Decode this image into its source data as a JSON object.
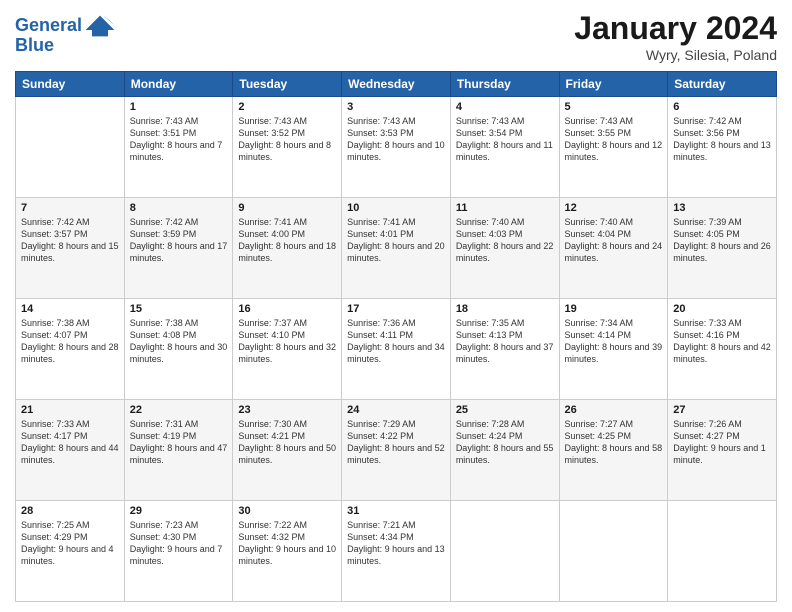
{
  "logo": {
    "line1": "General",
    "line2": "Blue"
  },
  "header": {
    "month": "January 2024",
    "location": "Wyry, Silesia, Poland"
  },
  "weekdays": [
    "Sunday",
    "Monday",
    "Tuesday",
    "Wednesday",
    "Thursday",
    "Friday",
    "Saturday"
  ],
  "weeks": [
    [
      {
        "day": "",
        "sunrise": "",
        "sunset": "",
        "daylight": ""
      },
      {
        "day": "1",
        "sunrise": "Sunrise: 7:43 AM",
        "sunset": "Sunset: 3:51 PM",
        "daylight": "Daylight: 8 hours and 7 minutes."
      },
      {
        "day": "2",
        "sunrise": "Sunrise: 7:43 AM",
        "sunset": "Sunset: 3:52 PM",
        "daylight": "Daylight: 8 hours and 8 minutes."
      },
      {
        "day": "3",
        "sunrise": "Sunrise: 7:43 AM",
        "sunset": "Sunset: 3:53 PM",
        "daylight": "Daylight: 8 hours and 10 minutes."
      },
      {
        "day": "4",
        "sunrise": "Sunrise: 7:43 AM",
        "sunset": "Sunset: 3:54 PM",
        "daylight": "Daylight: 8 hours and 11 minutes."
      },
      {
        "day": "5",
        "sunrise": "Sunrise: 7:43 AM",
        "sunset": "Sunset: 3:55 PM",
        "daylight": "Daylight: 8 hours and 12 minutes."
      },
      {
        "day": "6",
        "sunrise": "Sunrise: 7:42 AM",
        "sunset": "Sunset: 3:56 PM",
        "daylight": "Daylight: 8 hours and 13 minutes."
      }
    ],
    [
      {
        "day": "7",
        "sunrise": "Sunrise: 7:42 AM",
        "sunset": "Sunset: 3:57 PM",
        "daylight": "Daylight: 8 hours and 15 minutes."
      },
      {
        "day": "8",
        "sunrise": "Sunrise: 7:42 AM",
        "sunset": "Sunset: 3:59 PM",
        "daylight": "Daylight: 8 hours and 17 minutes."
      },
      {
        "day": "9",
        "sunrise": "Sunrise: 7:41 AM",
        "sunset": "Sunset: 4:00 PM",
        "daylight": "Daylight: 8 hours and 18 minutes."
      },
      {
        "day": "10",
        "sunrise": "Sunrise: 7:41 AM",
        "sunset": "Sunset: 4:01 PM",
        "daylight": "Daylight: 8 hours and 20 minutes."
      },
      {
        "day": "11",
        "sunrise": "Sunrise: 7:40 AM",
        "sunset": "Sunset: 4:03 PM",
        "daylight": "Daylight: 8 hours and 22 minutes."
      },
      {
        "day": "12",
        "sunrise": "Sunrise: 7:40 AM",
        "sunset": "Sunset: 4:04 PM",
        "daylight": "Daylight: 8 hours and 24 minutes."
      },
      {
        "day": "13",
        "sunrise": "Sunrise: 7:39 AM",
        "sunset": "Sunset: 4:05 PM",
        "daylight": "Daylight: 8 hours and 26 minutes."
      }
    ],
    [
      {
        "day": "14",
        "sunrise": "Sunrise: 7:38 AM",
        "sunset": "Sunset: 4:07 PM",
        "daylight": "Daylight: 8 hours and 28 minutes."
      },
      {
        "day": "15",
        "sunrise": "Sunrise: 7:38 AM",
        "sunset": "Sunset: 4:08 PM",
        "daylight": "Daylight: 8 hours and 30 minutes."
      },
      {
        "day": "16",
        "sunrise": "Sunrise: 7:37 AM",
        "sunset": "Sunset: 4:10 PM",
        "daylight": "Daylight: 8 hours and 32 minutes."
      },
      {
        "day": "17",
        "sunrise": "Sunrise: 7:36 AM",
        "sunset": "Sunset: 4:11 PM",
        "daylight": "Daylight: 8 hours and 34 minutes."
      },
      {
        "day": "18",
        "sunrise": "Sunrise: 7:35 AM",
        "sunset": "Sunset: 4:13 PM",
        "daylight": "Daylight: 8 hours and 37 minutes."
      },
      {
        "day": "19",
        "sunrise": "Sunrise: 7:34 AM",
        "sunset": "Sunset: 4:14 PM",
        "daylight": "Daylight: 8 hours and 39 minutes."
      },
      {
        "day": "20",
        "sunrise": "Sunrise: 7:33 AM",
        "sunset": "Sunset: 4:16 PM",
        "daylight": "Daylight: 8 hours and 42 minutes."
      }
    ],
    [
      {
        "day": "21",
        "sunrise": "Sunrise: 7:33 AM",
        "sunset": "Sunset: 4:17 PM",
        "daylight": "Daylight: 8 hours and 44 minutes."
      },
      {
        "day": "22",
        "sunrise": "Sunrise: 7:31 AM",
        "sunset": "Sunset: 4:19 PM",
        "daylight": "Daylight: 8 hours and 47 minutes."
      },
      {
        "day": "23",
        "sunrise": "Sunrise: 7:30 AM",
        "sunset": "Sunset: 4:21 PM",
        "daylight": "Daylight: 8 hours and 50 minutes."
      },
      {
        "day": "24",
        "sunrise": "Sunrise: 7:29 AM",
        "sunset": "Sunset: 4:22 PM",
        "daylight": "Daylight: 8 hours and 52 minutes."
      },
      {
        "day": "25",
        "sunrise": "Sunrise: 7:28 AM",
        "sunset": "Sunset: 4:24 PM",
        "daylight": "Daylight: 8 hours and 55 minutes."
      },
      {
        "day": "26",
        "sunrise": "Sunrise: 7:27 AM",
        "sunset": "Sunset: 4:25 PM",
        "daylight": "Daylight: 8 hours and 58 minutes."
      },
      {
        "day": "27",
        "sunrise": "Sunrise: 7:26 AM",
        "sunset": "Sunset: 4:27 PM",
        "daylight": "Daylight: 9 hours and 1 minute."
      }
    ],
    [
      {
        "day": "28",
        "sunrise": "Sunrise: 7:25 AM",
        "sunset": "Sunset: 4:29 PM",
        "daylight": "Daylight: 9 hours and 4 minutes."
      },
      {
        "day": "29",
        "sunrise": "Sunrise: 7:23 AM",
        "sunset": "Sunset: 4:30 PM",
        "daylight": "Daylight: 9 hours and 7 minutes."
      },
      {
        "day": "30",
        "sunrise": "Sunrise: 7:22 AM",
        "sunset": "Sunset: 4:32 PM",
        "daylight": "Daylight: 9 hours and 10 minutes."
      },
      {
        "day": "31",
        "sunrise": "Sunrise: 7:21 AM",
        "sunset": "Sunset: 4:34 PM",
        "daylight": "Daylight: 9 hours and 13 minutes."
      },
      {
        "day": "",
        "sunrise": "",
        "sunset": "",
        "daylight": ""
      },
      {
        "day": "",
        "sunrise": "",
        "sunset": "",
        "daylight": ""
      },
      {
        "day": "",
        "sunrise": "",
        "sunset": "",
        "daylight": ""
      }
    ]
  ]
}
